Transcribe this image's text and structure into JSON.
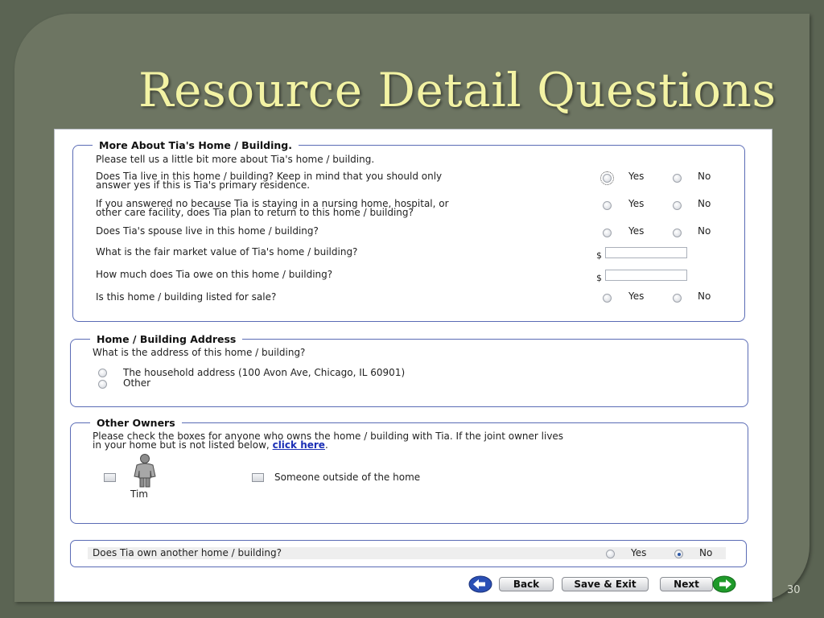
{
  "slide": {
    "title": "Resource Detail Questions",
    "page_number": "30"
  },
  "section_home": {
    "legend": "More About Tia's Home / Building.",
    "intro": "Please tell us a little bit more about Tia's home / building.",
    "q1_line1": "Does Tia live in this home / building? Keep in mind that you should only",
    "q1_line2": "answer yes if this is Tia's primary residence.",
    "q2_line1": "If you answered no because Tia is staying in a nursing home, hospital, or",
    "q2_line2": "other care facility, does Tia plan to return to this home / building?",
    "q3": "Does Tia's spouse live in this home / building?",
    "q4": "What is the fair market value of Tia's home / building?",
    "q5": "How much does Tia owe on this home / building?",
    "q6": "Is this home / building listed for sale?",
    "yes_label": "Yes",
    "no_label": "No",
    "currency_symbol": "$",
    "market_value": "",
    "amount_owed": ""
  },
  "section_address": {
    "legend": "Home / Building Address",
    "question": "What is the address of this home / building?",
    "option_household": "The household address (100 Avon Ave, Chicago, IL 60901)",
    "option_other": "Other"
  },
  "section_owners": {
    "legend": "Other Owners",
    "instruction_line1": "Please check the boxes for anyone who owns the home / building with Tia. If the joint owner lives",
    "instruction_line2_prefix": "in your home but is not listed below,",
    "link_text": "click here",
    "instruction_line2_suffix": ".",
    "person_name": "Tim",
    "outside_label": "Someone outside of the home"
  },
  "section_another": {
    "question": "Does Tia own another home / building?",
    "yes_label": "Yes",
    "no_label": "No",
    "selected": "No"
  },
  "nav": {
    "back_label": "Back",
    "save_exit_label": "Save & Exit",
    "next_label": "Next"
  },
  "colors": {
    "slide_bg": "#5b6453",
    "title_color": "#f3f3a4",
    "fieldset_border": "#5a6bb5",
    "back_arrow": "#2a4fb5",
    "next_arrow": "#1f9a2a"
  }
}
